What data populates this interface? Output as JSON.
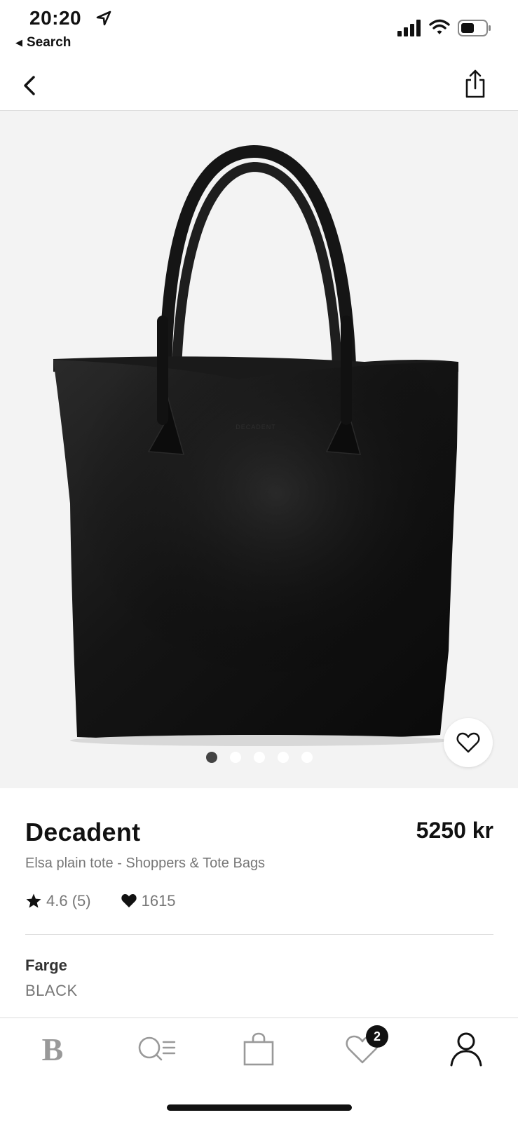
{
  "status_bar": {
    "time": "20:20",
    "back_app_label": "Search"
  },
  "nav": {
    "back_icon": "chevron-left-icon",
    "share_icon": "share-icon"
  },
  "gallery": {
    "image_count": 5,
    "active_index": 0,
    "favorite_icon": "heart-outline-icon",
    "imprint_text": "DECADENT"
  },
  "product": {
    "brand": "Decadent",
    "price": "5250 kr",
    "subtitle": "Elsa plain tote - Shoppers & Tote Bags",
    "rating": "4.6 (5)",
    "likes": "1615",
    "color_label": "Farge",
    "color_value": "BLACK"
  },
  "tab_bar": {
    "items": [
      {
        "label": "B",
        "icon": "brand-logo-icon"
      },
      {
        "label": "",
        "icon": "search-list-icon"
      },
      {
        "label": "",
        "icon": "shopping-bag-icon"
      },
      {
        "label": "",
        "icon": "heart-icon",
        "badge": "2"
      },
      {
        "label": "",
        "icon": "user-icon"
      }
    ]
  },
  "colors": {
    "accent": "#111111",
    "muted_text": "#777777",
    "hero_bg": "#f3f3f3"
  }
}
